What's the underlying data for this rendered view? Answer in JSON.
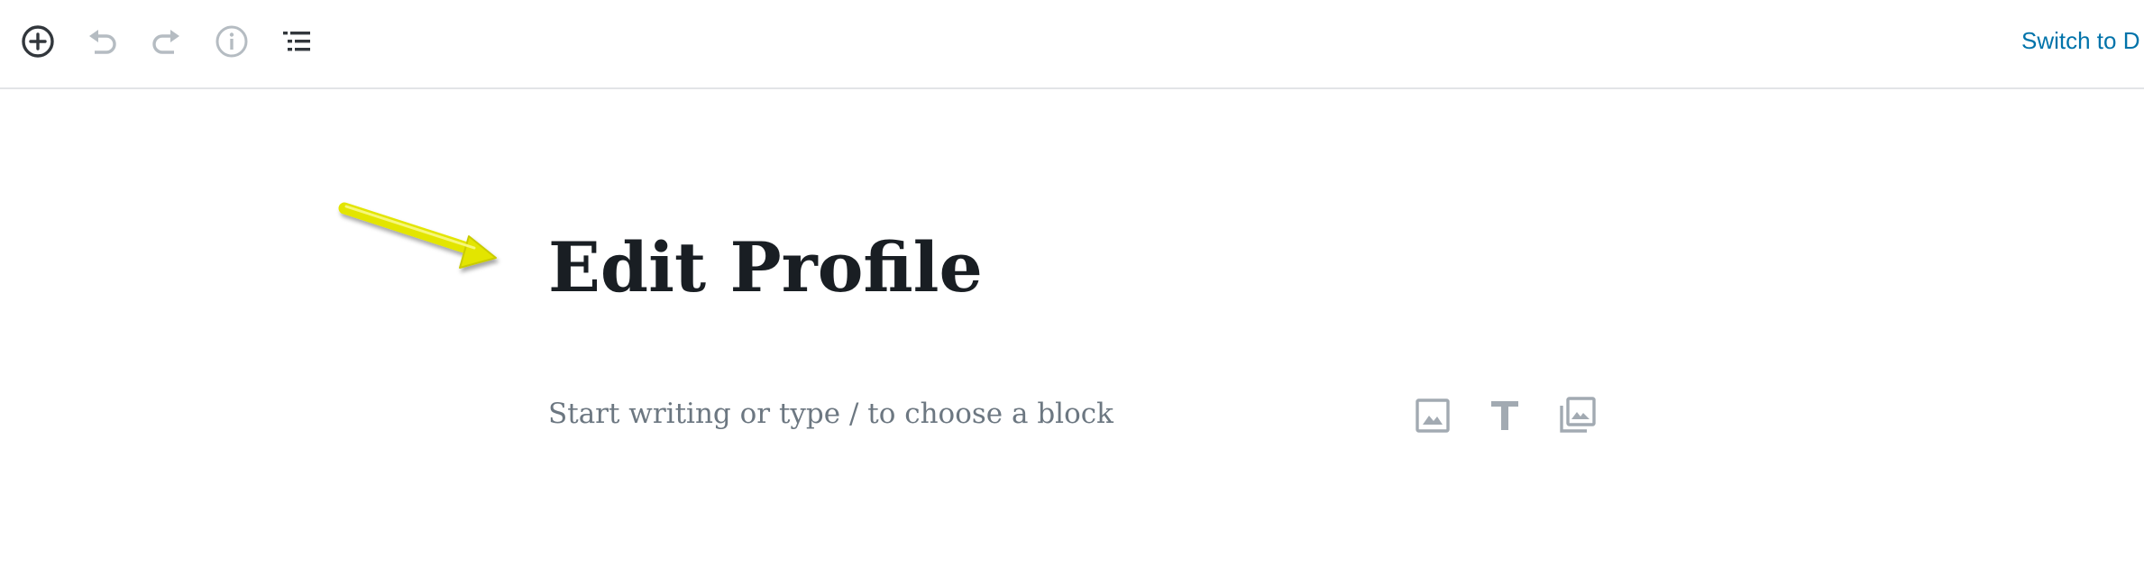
{
  "toolbar": {
    "buttons": [
      {
        "name": "add-block",
        "icon": "plus-circle-icon"
      },
      {
        "name": "undo",
        "icon": "undo-icon"
      },
      {
        "name": "redo",
        "icon": "redo-icon"
      },
      {
        "name": "content-structure",
        "icon": "info-icon"
      },
      {
        "name": "block-navigation",
        "icon": "list-view-icon"
      }
    ],
    "switch_label": "Switch to D"
  },
  "editor": {
    "title": "Edit Profile",
    "placeholder": "Start writing or type / to choose a block",
    "shortcuts": [
      {
        "name": "image",
        "icon": "image-icon"
      },
      {
        "name": "heading",
        "icon": "heading-t-icon"
      },
      {
        "name": "gallery",
        "icon": "gallery-icon"
      }
    ]
  },
  "colors": {
    "link": "#0073aa",
    "title": "#191e23",
    "placeholder": "#6c7781",
    "icon_dark": "#555d66",
    "icon_disabled": "#b5bcc2",
    "annotation_arrow": "#e8ea0c"
  }
}
